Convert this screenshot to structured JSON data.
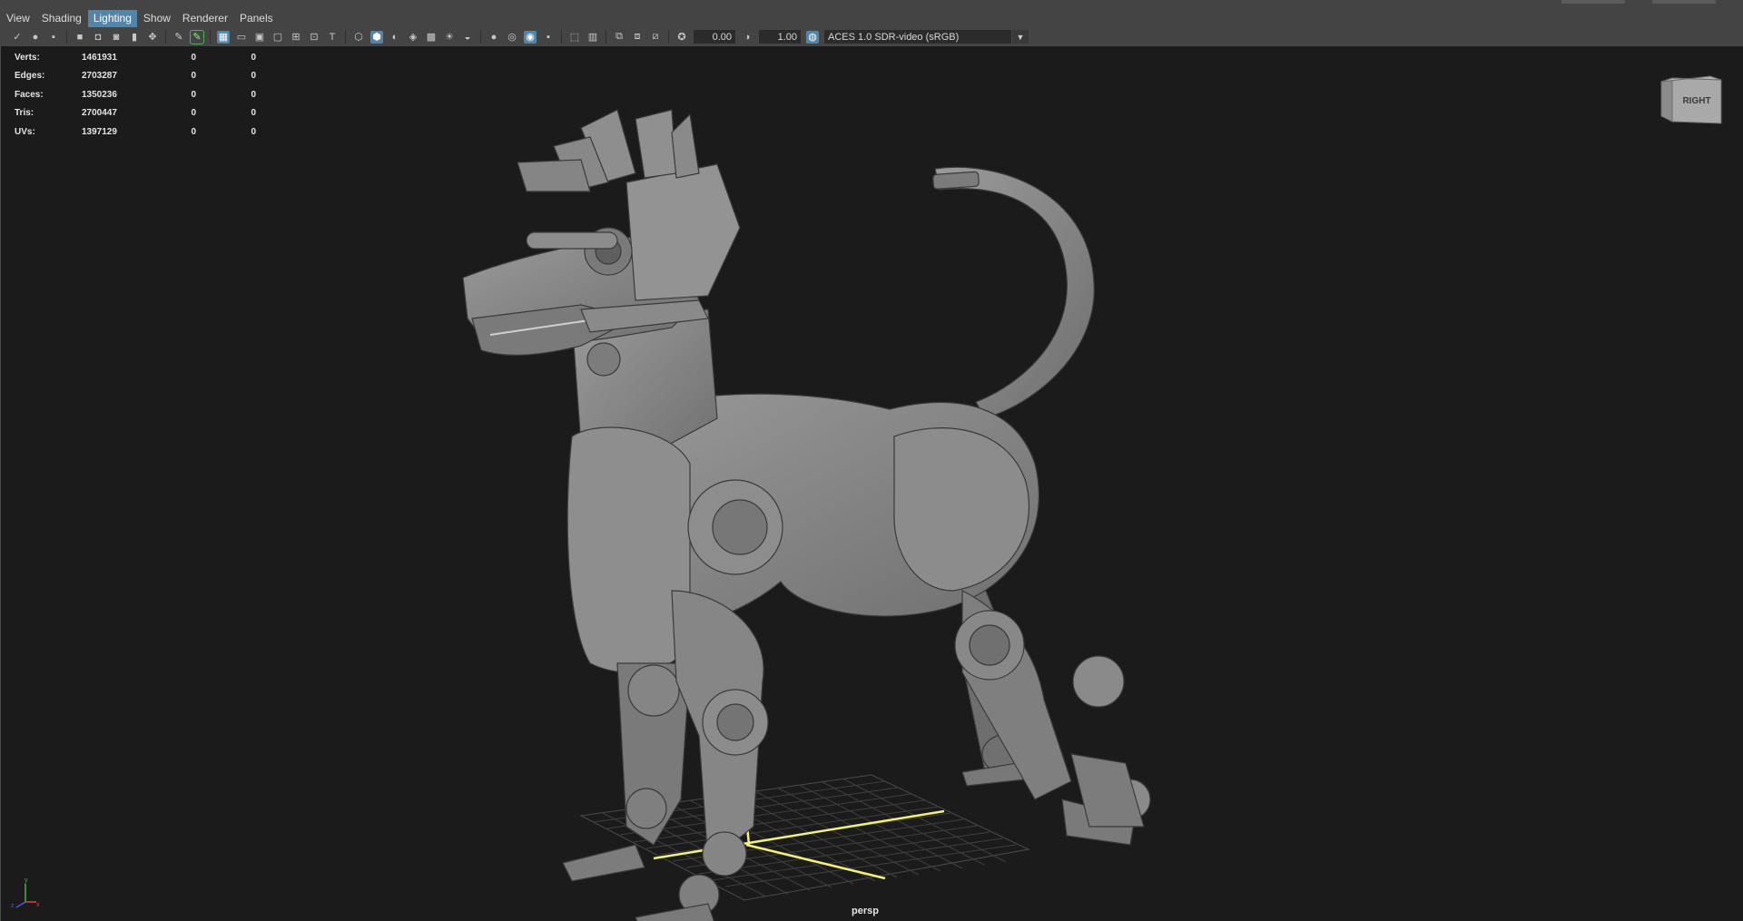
{
  "menubar": {
    "items": [
      {
        "label": "View",
        "active": false
      },
      {
        "label": "Shading",
        "active": false
      },
      {
        "label": "Lighting",
        "active": true
      },
      {
        "label": "Show",
        "active": false
      },
      {
        "label": "Renderer",
        "active": false
      },
      {
        "label": "Panels",
        "active": false
      }
    ]
  },
  "toolbar": {
    "exposure_value": "0.00",
    "gamma_value": "1.00",
    "view_transform": "ACES 1.0 SDR-video (sRGB)"
  },
  "stats": {
    "rows": [
      {
        "label": "Verts:",
        "value": "1461931",
        "sel": "0",
        "comp": "0"
      },
      {
        "label": "Edges:",
        "value": "2703287",
        "sel": "0",
        "comp": "0"
      },
      {
        "label": "Faces:",
        "value": "1350236",
        "sel": "0",
        "comp": "0"
      },
      {
        "label": "Tris:",
        "value": "2700447",
        "sel": "0",
        "comp": "0"
      },
      {
        "label": "UVs:",
        "value": "1397129",
        "sel": "0",
        "comp": "0"
      }
    ]
  },
  "viewcube": {
    "face_label": "RIGHT"
  },
  "camera": {
    "name": "persp"
  },
  "colors": {
    "menu_bg": "#444444",
    "viewport_bg": "#1b1b1b",
    "selection_blue": "#5285a6",
    "grid_axis": "#f2f27a"
  }
}
